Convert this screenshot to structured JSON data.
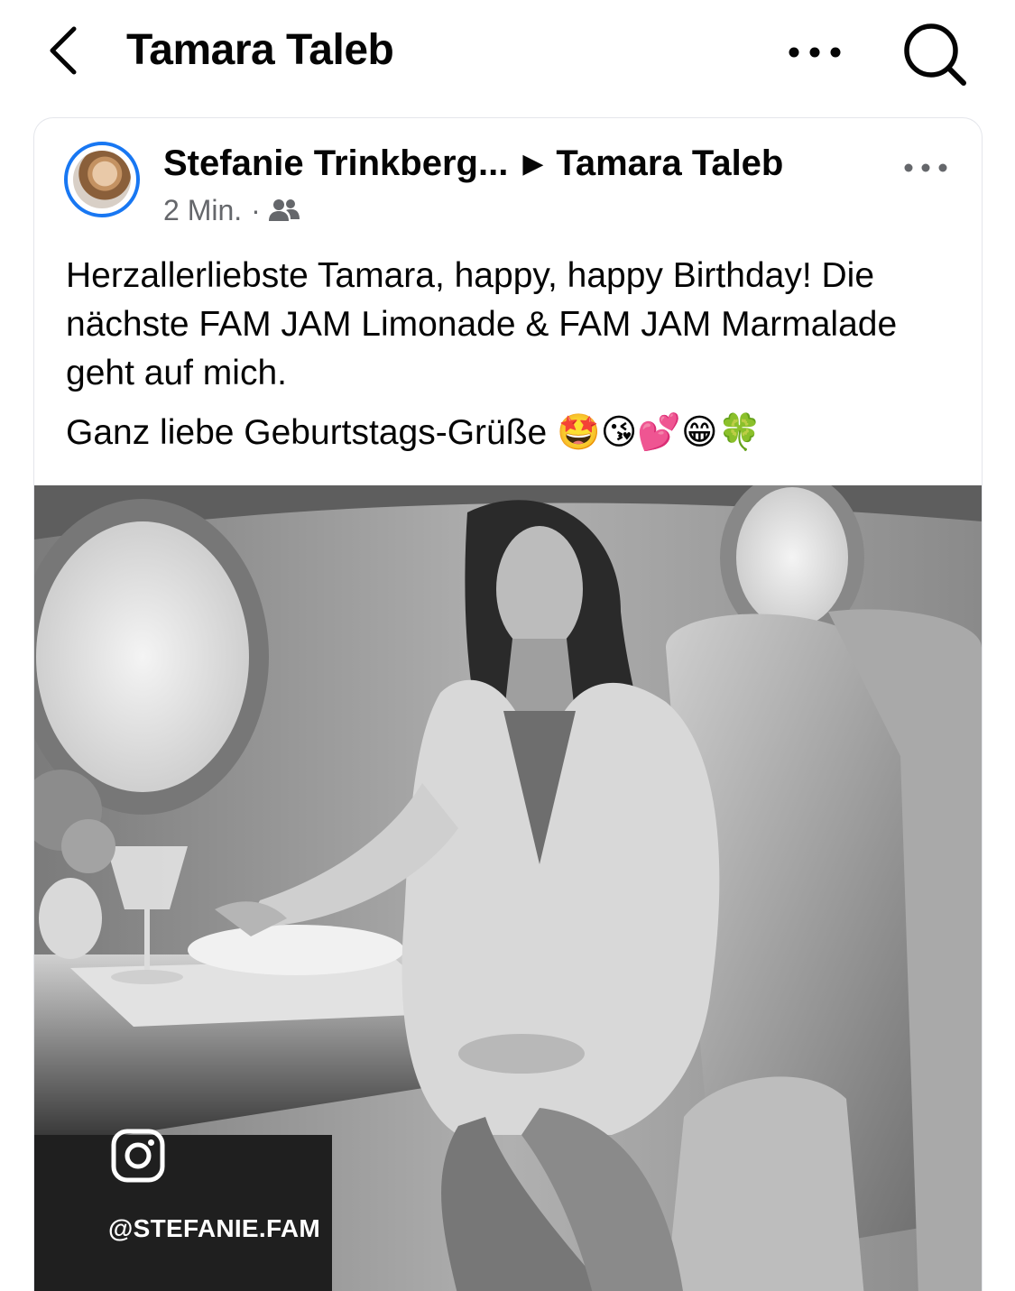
{
  "header": {
    "title": "Tamara Taleb",
    "icons": {
      "back": "chevron-left-icon",
      "more": "more-icon",
      "search": "search-icon"
    }
  },
  "post": {
    "author": "Stefanie Trinkberg...",
    "target": "Tamara Taleb",
    "time": "2 Min.",
    "audience_icon": "friends-icon",
    "text_line1": "Herzallerliebste Tamara, happy, happy Birthday! Die nächste FAM JAM Limonade & FAM JAM Marmalade geht auf mich.",
    "text_line2": "Ganz liebe Geburtstags-Grüße 🤩😘💕😁🍀",
    "photo": {
      "watermark_icon": "instagram-icon",
      "watermark_handle": "@STEFANIE.FAM"
    }
  },
  "colors": {
    "accent": "#1877f2",
    "text": "#050505",
    "secondary_text": "#65676b",
    "border": "#e4e6eb"
  }
}
